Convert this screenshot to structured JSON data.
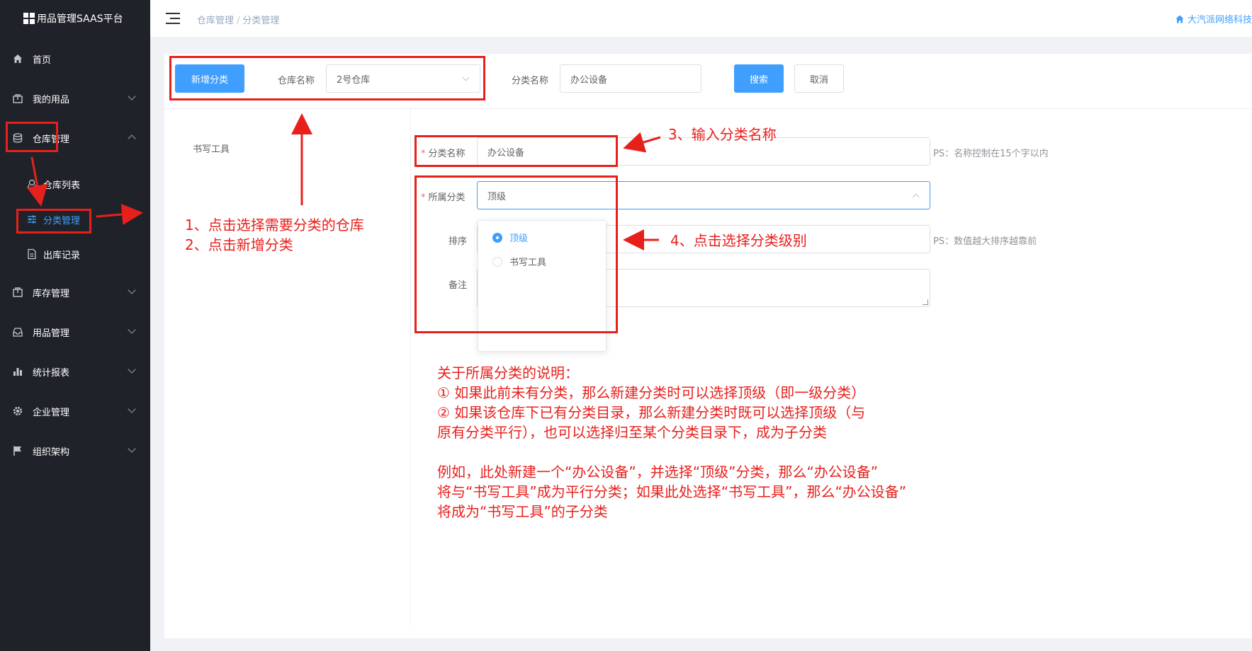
{
  "app": {
    "title": "用品管理SAAS平台",
    "company": "大汽派网络科技"
  },
  "breadcrumb": [
    "仓库管理",
    "分类管理"
  ],
  "sidebar": {
    "items": [
      {
        "label": "首页",
        "icon": "home-icon"
      },
      {
        "label": "我的用品",
        "icon": "bag-icon"
      },
      {
        "label": "仓库管理",
        "icon": "database-icon"
      },
      {
        "label": "库存管理",
        "icon": "box-icon"
      },
      {
        "label": "用品管理",
        "icon": "inbox-icon"
      },
      {
        "label": "统计报表",
        "icon": "bar-chart-icon"
      },
      {
        "label": "企业管理",
        "icon": "gear-icon"
      },
      {
        "label": "组织架构",
        "icon": "flag-icon"
      }
    ],
    "sub_items": [
      {
        "label": "仓库列表",
        "icon": "location-icon"
      },
      {
        "label": "分类管理",
        "icon": "sliders-icon"
      },
      {
        "label": "出库记录",
        "icon": "document-icon"
      }
    ]
  },
  "toolbar": {
    "add_button": "新增分类",
    "warehouse_label": "仓库名称",
    "warehouse_value": "2号仓库",
    "category_label": "分类名称",
    "category_value": "办公设备",
    "search_button": "搜索",
    "cancel_button": "取消"
  },
  "tree": {
    "nodes": [
      "书写工具"
    ]
  },
  "form": {
    "name_label": "分类名称",
    "name_value": "办公设备",
    "name_hint": "PS：名称控制在15个字以内",
    "parent_label": "所属分类",
    "parent_value": "顶级",
    "sort_label": "排序",
    "sort_hint": "PS：数值越大排序越靠前",
    "remark_label": "备注",
    "parent_options": [
      "顶级",
      "书写工具"
    ]
  },
  "annotations": {
    "step12_line1": "1、点击选择需要分类的仓库",
    "step12_line2": "2、点击新增分类",
    "step3": "3、输入分类名称",
    "step4": "4、点击选择分类级别",
    "explain": [
      "关于所属分类的说明：",
      "① 如果此前未有分类，那么新建分类时可以选择顶级（即一级分类）",
      "② 如果该仓库下已有分类目录，那么新建分类时既可以选择顶级（与",
      "原有分类平行），也可以选择归至某个分类目录下，成为子分类",
      "例如，此处新建一个“办公设备”，并选择“顶级”分类，那么“办公设备”",
      "将与“书写工具”成为平行分类；如果此处选择“书写工具”，那么“办公设备”",
      "将成为“书写工具”的子分类"
    ]
  },
  "colors": {
    "sidebar_bg": "#1f2329",
    "primary": "#409eff",
    "annotation_red": "#e8201c"
  }
}
